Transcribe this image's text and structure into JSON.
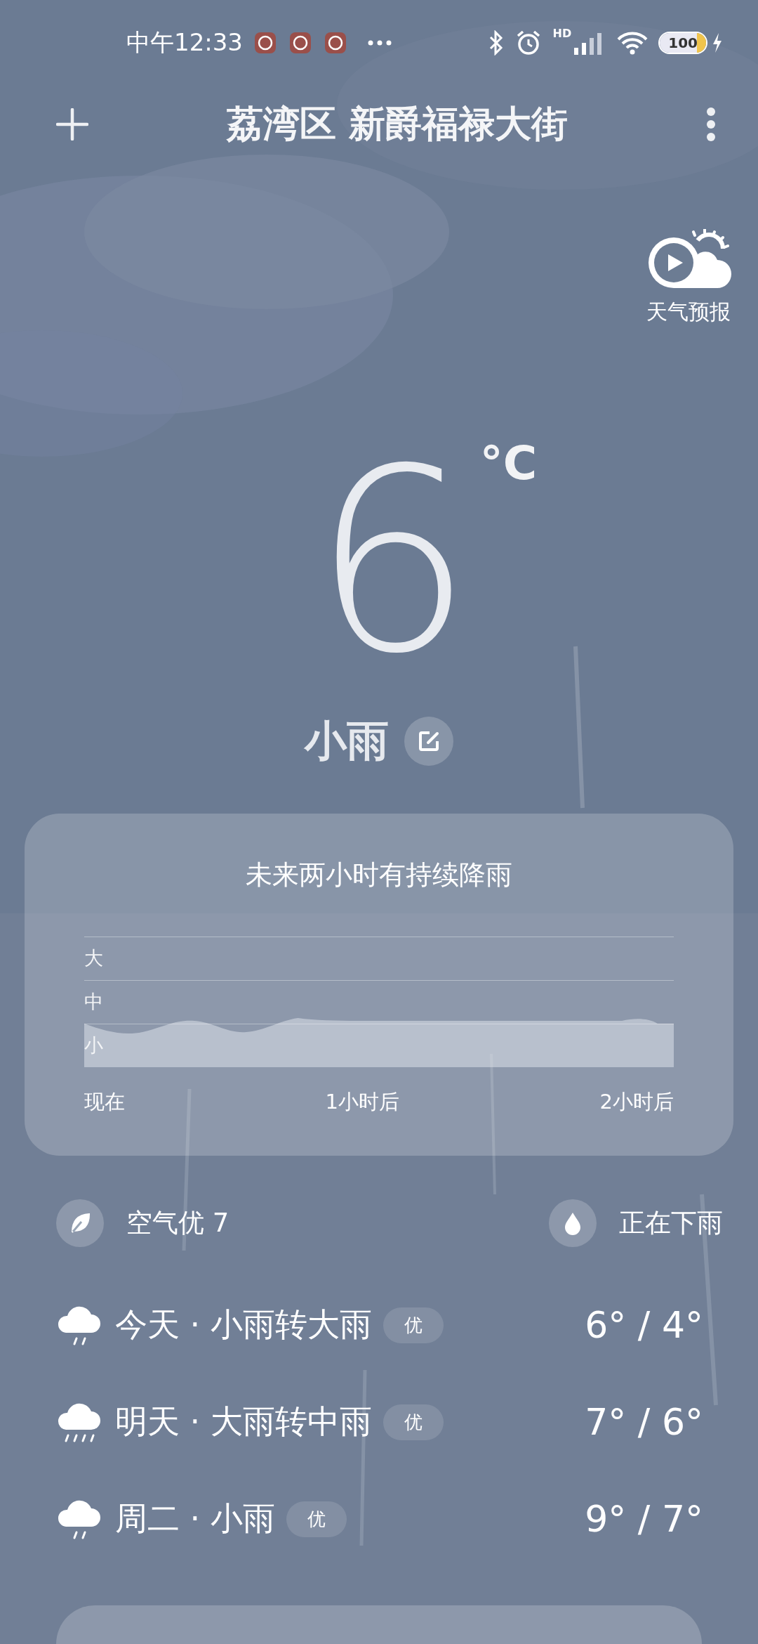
{
  "status_bar": {
    "time": "中午12:33",
    "network_label": "HD",
    "battery": "100"
  },
  "header": {
    "location": "荔湾区 新爵福禄大街"
  },
  "video_forecast": {
    "label": "天气预报"
  },
  "current": {
    "temperature": "6",
    "unit": "°C",
    "condition": "小雨"
  },
  "rain_card": {
    "title": "未来两小时有持续降雨",
    "levels": [
      "大",
      "中",
      "小"
    ],
    "times": [
      "现在",
      "1小时后",
      "2小时后"
    ]
  },
  "indicators": [
    {
      "kind": "air",
      "label": "空气优 7"
    },
    {
      "kind": "rain",
      "label": "正在下雨"
    }
  ],
  "forecast": [
    {
      "kind": "light_rain",
      "label": "今天 · 小雨转大雨",
      "air": "优",
      "temps": "6° / 4°"
    },
    {
      "kind": "heavy_rain",
      "label": "明天 · 大雨转中雨",
      "air": "优",
      "temps": "7° / 6°"
    },
    {
      "kind": "light_rain",
      "label": "周二 · 小雨",
      "air": "优",
      "temps": "9° / 7°"
    }
  ]
}
